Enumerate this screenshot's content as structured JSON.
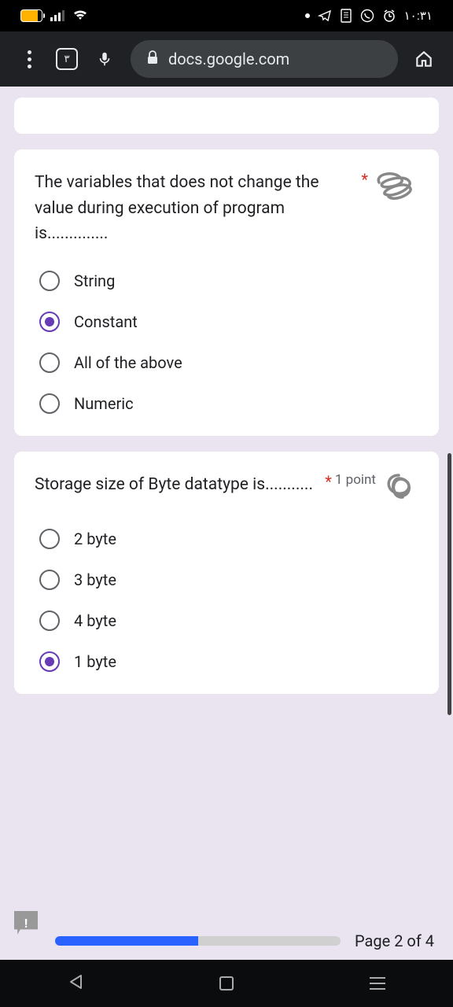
{
  "statusbar": {
    "time": "١٠:٣١"
  },
  "browser": {
    "tabcount": "٣",
    "url": "docs.google.com"
  },
  "questions": [
    {
      "text": "The variables that does not change the value during execution of program is..............",
      "points": "",
      "selected": 1,
      "options": [
        "String",
        "Constant",
        "All of the above",
        "Numeric"
      ]
    },
    {
      "text": "Storage size of Byte datatype is...........",
      "points": "1 point",
      "selected": 3,
      "options": [
        "2 byte",
        "3 byte",
        "4 byte",
        "1 byte"
      ]
    }
  ],
  "progress": {
    "label": "Page 2 of 4",
    "percent": 50
  }
}
